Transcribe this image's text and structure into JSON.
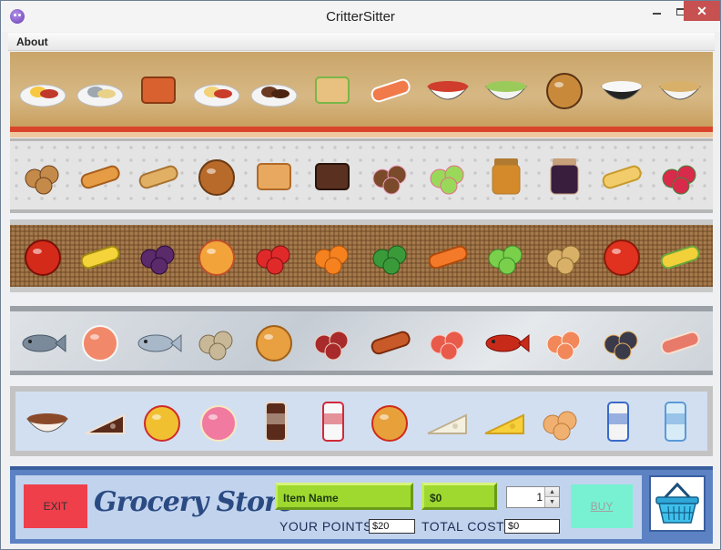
{
  "window": {
    "title": "CritterSitter",
    "minimize": "",
    "maximize": "",
    "close": "✕"
  },
  "menu": {
    "items": [
      {
        "label": "About"
      }
    ]
  },
  "shelves": [
    {
      "id": "meals",
      "items": [
        "breakfast-plate-icon",
        "grilled-fish-icon",
        "lasagna-icon",
        "spaghetti-icon",
        "steak-icon",
        "sandwich-icon",
        "sushi-icon",
        "tomato-soup-icon",
        "greek-salad-icon",
        "hamburger-icon",
        "rice-bowl-icon",
        "noodle-soup-icon"
      ]
    },
    {
      "id": "bakery",
      "items": [
        "cookies-icon",
        "croissant-icon",
        "baguette-icon",
        "pretzel-icon",
        "toast-icon",
        "chocolate-bar-icon",
        "donuts-icon",
        "macarons-icon",
        "peanut-butter-icon",
        "jam-jar-icon",
        "potato-chips-icon",
        "candy-icon"
      ]
    },
    {
      "id": "produce",
      "items": [
        "apple-icon",
        "bananas-icon",
        "grapes-icon",
        "mango-icon",
        "strawberries-icon",
        "oranges-icon",
        "broccoli-icon",
        "carrot-icon",
        "lettuce-icon",
        "potatoes-icon",
        "tomato-icon",
        "corn-icon"
      ]
    },
    {
      "id": "seafood",
      "items": [
        "fish-icon",
        "salmon-steak-icon",
        "sardine-icon",
        "oysters-icon",
        "roast-chicken-icon",
        "salami-icon",
        "sausage-icon",
        "octopus-icon",
        "lobster-icon",
        "shrimp-icon",
        "mussels-icon",
        "bacon-icon"
      ]
    },
    {
      "id": "dairy",
      "items": [
        "ice-cream-sundae-icon",
        "chocolate-cake-icon",
        "pudding-icon",
        "strawberry-cake-icon",
        "popsicle-icon",
        "yogurt-icon",
        "pizza-icon",
        "brie-cheese-icon",
        "swiss-cheese-icon",
        "eggs-icon",
        "milk-carton-icon",
        "water-bottles-icon"
      ]
    }
  ],
  "store": {
    "exit_label": "EXIT",
    "logo_text": "Grocery Store",
    "item_name": "Item Name",
    "price": "$0",
    "quantity": "1",
    "points_label": "YOUR POINTS:",
    "points_value": "$20",
    "cost_label": "TOTAL COST:",
    "cost_value": "$0",
    "buy_label": "BUY"
  },
  "colors": {
    "exit": "#ee3f4b",
    "buy": "#77f1d1",
    "field_green": "#9fd82f",
    "toolbar": "#5c82c4"
  }
}
